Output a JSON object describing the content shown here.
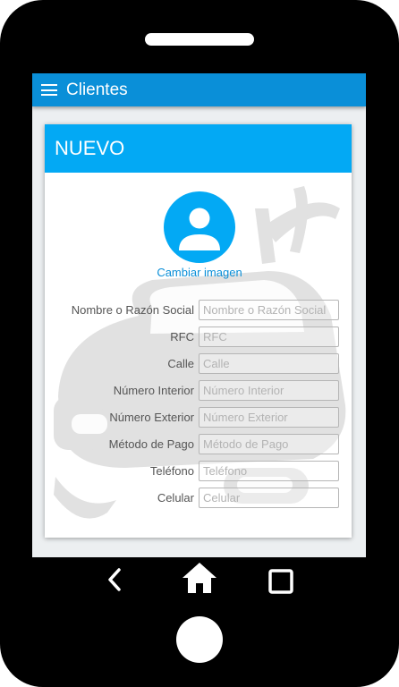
{
  "app_bar": {
    "title": "Clientes",
    "menu_icon": "hamburger-menu-icon",
    "color": "#0a8fd8"
  },
  "card": {
    "header_title": "NUEVO",
    "header_color": "#03a9f4",
    "avatar_icon": "person-icon",
    "change_image_label": "Cambiar imagen"
  },
  "form": {
    "fields": [
      {
        "label": "Nombre o Razón Social",
        "placeholder": "Nombre o Razón Social",
        "value": ""
      },
      {
        "label": "RFC",
        "placeholder": "RFC",
        "value": ""
      },
      {
        "label": "Calle",
        "placeholder": "Calle",
        "value": ""
      },
      {
        "label": "Número Interior",
        "placeholder": "Número Interior",
        "value": ""
      },
      {
        "label": "Número Exterior",
        "placeholder": "Número Exterior",
        "value": ""
      },
      {
        "label": "Método de Pago",
        "placeholder": "Método de Pago",
        "value": ""
      },
      {
        "label": "Teléfono",
        "placeholder": "Teléfono",
        "value": ""
      },
      {
        "label": "Celular",
        "placeholder": "Celular",
        "value": ""
      }
    ]
  },
  "navigation": {
    "back_icon": "back-chevron-icon",
    "home_icon": "home-icon",
    "recents_icon": "recents-square-icon"
  },
  "background_watermark": "car-illustration"
}
